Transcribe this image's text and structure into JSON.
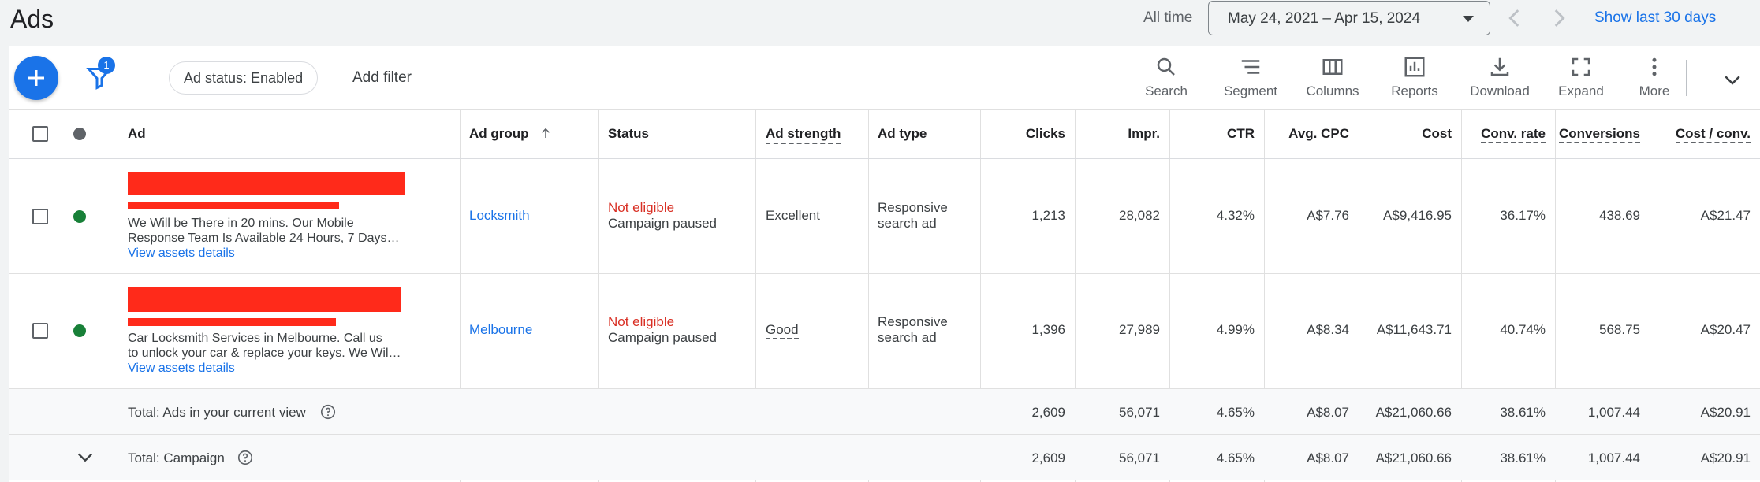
{
  "header": {
    "title": "Ads",
    "all_time": "All time",
    "date_range": "May 24, 2021 – Apr 15, 2024",
    "show_last": "Show last 30 days"
  },
  "toolbar": {
    "filter_count": "1",
    "chip": "Ad status: Enabled",
    "add_filter": "Add filter",
    "tools": [
      "Search",
      "Segment",
      "Columns",
      "Reports",
      "Download",
      "Expand",
      "More"
    ]
  },
  "columns": {
    "ad": "Ad",
    "ad_group": "Ad group",
    "status": "Status",
    "ad_strength": "Ad strength",
    "ad_type": "Ad type",
    "clicks": "Clicks",
    "impr": "Impr.",
    "ctr": "CTR",
    "avg_cpc": "Avg. CPC",
    "cost": "Cost",
    "conv_rate": "Conv. rate",
    "conversions": "Conversions",
    "cost_conv": "Cost / conv."
  },
  "rows": [
    {
      "desc_1": "We Will be There in 20 mins. Our Mobile",
      "desc_2": "Response Team Is Available 24 Hours, 7 Days…",
      "details": "View assets details",
      "ad_group": "Locksmith",
      "status": "Not eligible",
      "status_sub": "Campaign paused",
      "ad_strength": "Excellent",
      "ad_type_1": "Responsive",
      "ad_type_2": "search ad",
      "clicks": "1,213",
      "impr": "28,082",
      "ctr": "4.32%",
      "avg_cpc": "A$7.76",
      "cost": "A$9,416.95",
      "conv_rate": "36.17%",
      "conversions": "438.69",
      "cost_conv": "A$21.47"
    },
    {
      "desc_1": "Car Locksmith Services in Melbourne. Call us",
      "desc_2": "to unlock your car & replace your keys. We Wil…",
      "details": "View assets details",
      "ad_group": "Melbourne",
      "status": "Not eligible",
      "status_sub": "Campaign paused",
      "ad_strength": "Good",
      "ad_type_1": "Responsive",
      "ad_type_2": "search ad",
      "clicks": "1,396",
      "impr": "27,989",
      "ctr": "4.99%",
      "avg_cpc": "A$8.34",
      "cost": "A$11,643.71",
      "conv_rate": "40.74%",
      "conversions": "568.75",
      "cost_conv": "A$20.47"
    }
  ],
  "totals": [
    {
      "label": "Total: Ads in your current view",
      "clicks": "2,609",
      "impr": "56,071",
      "ctr": "4.65%",
      "avg_cpc": "A$8.07",
      "cost": "A$21,060.66",
      "conv_rate": "38.61%",
      "conversions": "1,007.44",
      "cost_conv": "A$20.91"
    },
    {
      "label": "Total: Campaign",
      "clicks": "2,609",
      "impr": "56,071",
      "ctr": "4.65%",
      "avg_cpc": "A$8.07",
      "cost": "A$21,060.66",
      "conv_rate": "38.61%",
      "conversions": "1,007.44",
      "cost_conv": "A$20.91"
    }
  ],
  "colors": {
    "accent": "#1a73e8",
    "status_enabled": "#188038",
    "not_eligible": "#d93025",
    "redaction": "#ff2a1a"
  }
}
